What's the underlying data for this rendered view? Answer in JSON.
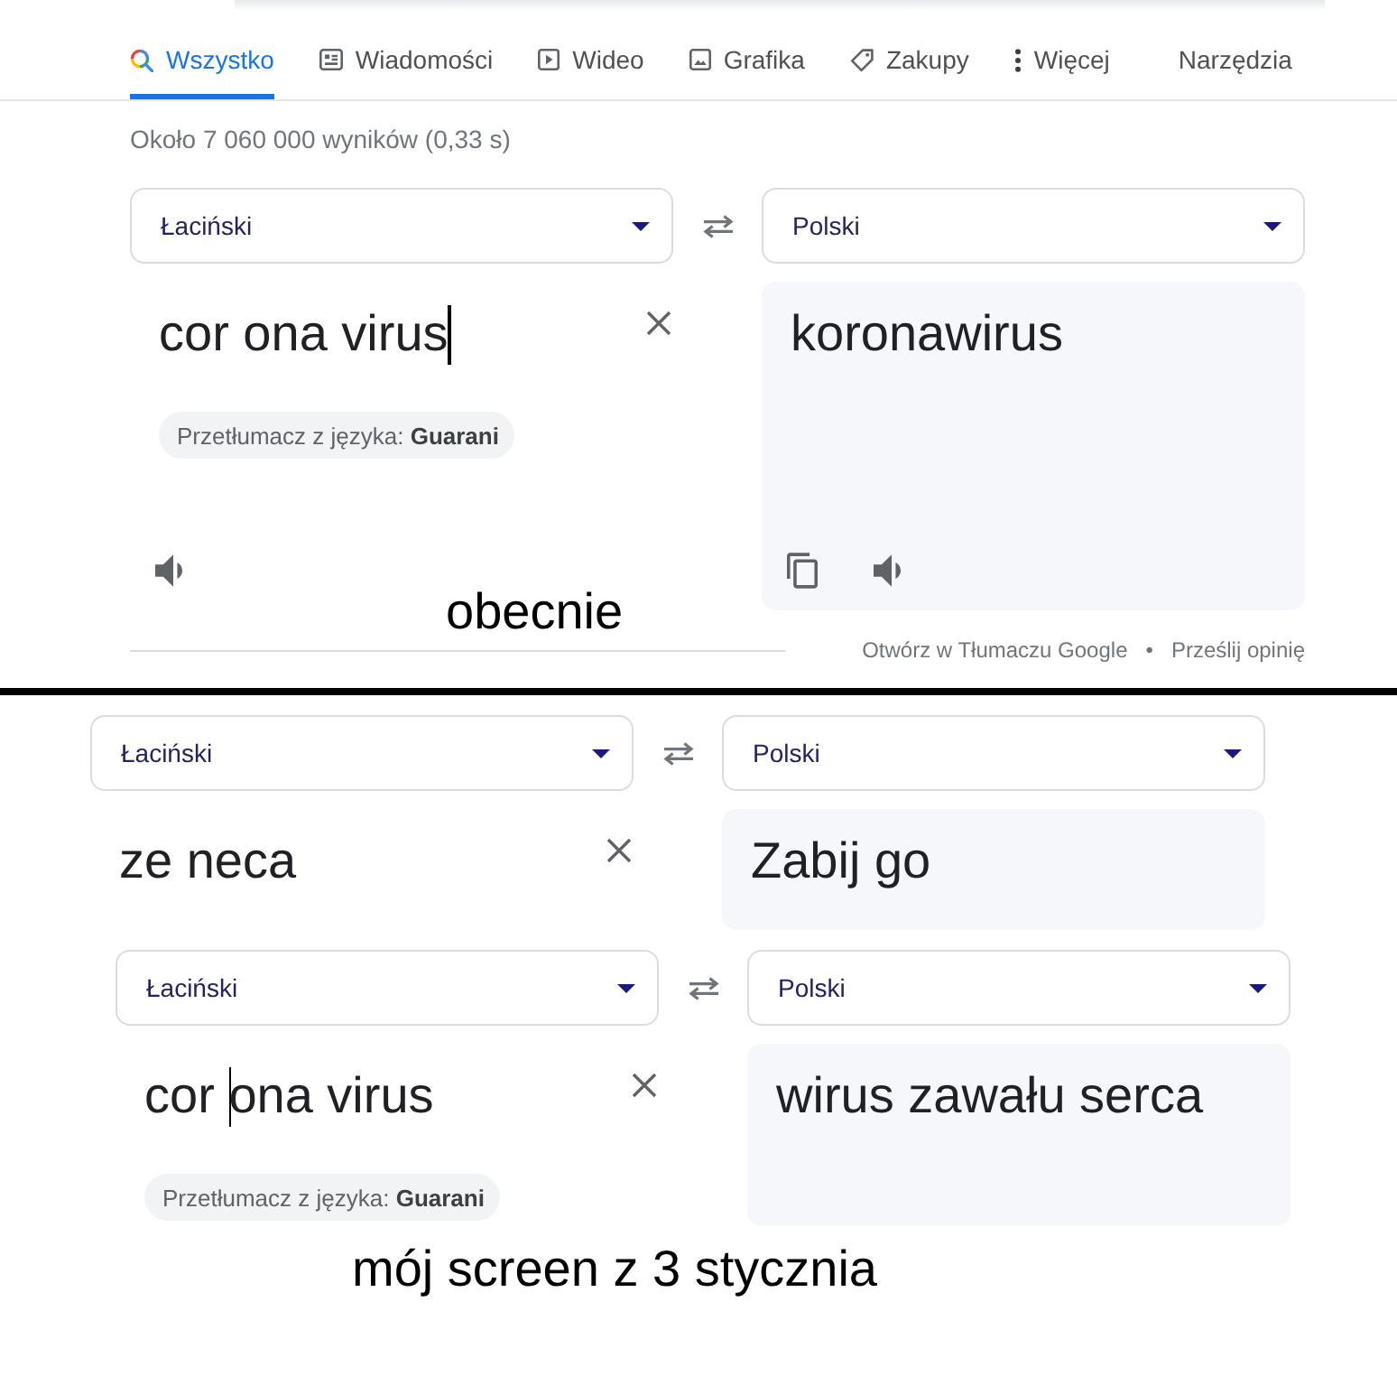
{
  "search_tabs": [
    {
      "label": "Wszystko",
      "kind": "search",
      "selected": true
    },
    {
      "label": "Wiadomości",
      "kind": "news",
      "selected": false
    },
    {
      "label": "Wideo",
      "kind": "video",
      "selected": false
    },
    {
      "label": "Grafika",
      "kind": "images",
      "selected": false
    },
    {
      "label": "Zakupy",
      "kind": "shopping",
      "selected": false
    },
    {
      "label": "Więcej",
      "kind": "more",
      "selected": false
    }
  ],
  "tools_button": "Narzędzia",
  "result_stats": "Około 7 060 000 wyników (0,33 s)",
  "screenshots": [
    {
      "translators": [
        {
          "source_language": "Łaciński",
          "target_language": "Polski",
          "source_text": [
            "cor ona virus"
          ],
          "caret": true,
          "detected_language_hint": "Przetłumacz z języka: **Guarani**",
          "translation": "koronawirus",
          "action_icons": true,
          "caption": "obecnie",
          "footer": {
            "links": [
              "Otwórz w Tłumaczu Google",
              "Prześlij opinię"
            ],
            "separator": "•"
          }
        }
      ]
    },
    {
      "translators": [
        {
          "source_language": "Łaciński",
          "target_language": "Polski",
          "source_text": [
            "ze neca"
          ],
          "caret": false,
          "translation": "Zabij go",
          "action_icons": false
        },
        {
          "source_language": "Łaciński",
          "target_language": "Polski",
          "source_text": [
            "cor ",
            "ona virus"
          ],
          "caret": true,
          "detected_language_hint": "Przetłumacz z języka: **Guarani**",
          "translation": "wirus zawału serca",
          "action_icons": false,
          "caption": "mój screen z 3 stycznia"
        }
      ]
    }
  ]
}
